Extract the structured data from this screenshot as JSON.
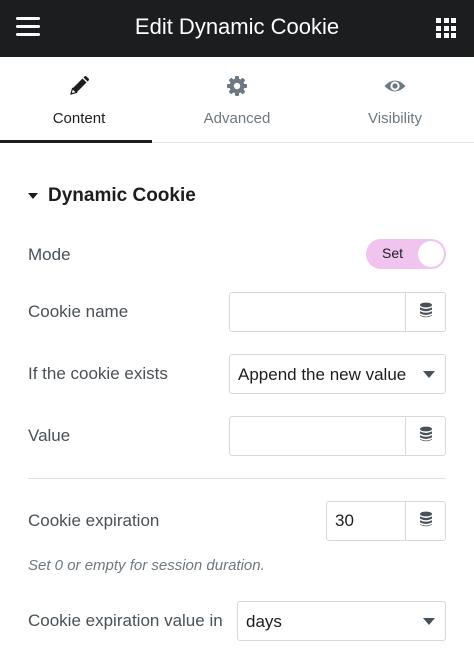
{
  "header": {
    "title": "Edit Dynamic Cookie"
  },
  "tabs": [
    {
      "label": "Content",
      "icon": "pencil-icon",
      "active": true
    },
    {
      "label": "Advanced",
      "icon": "gear-icon",
      "active": false
    },
    {
      "label": "Visibility",
      "icon": "eye-icon",
      "active": false
    }
  ],
  "section": {
    "title": "Dynamic Cookie"
  },
  "fields": {
    "mode": {
      "label": "Mode",
      "toggle_text": "Set",
      "toggle_color": "#f0c4ee"
    },
    "cookie_name": {
      "label": "Cookie name",
      "value": ""
    },
    "if_exists": {
      "label": "If the cookie exists",
      "value": "Append the new value"
    },
    "value": {
      "label": "Value",
      "value": ""
    },
    "expiration": {
      "label": "Cookie expiration",
      "value": "30",
      "hint": "Set 0 or empty for session duration."
    },
    "expiration_unit": {
      "label": "Cookie expiration value in",
      "value": "days"
    }
  }
}
